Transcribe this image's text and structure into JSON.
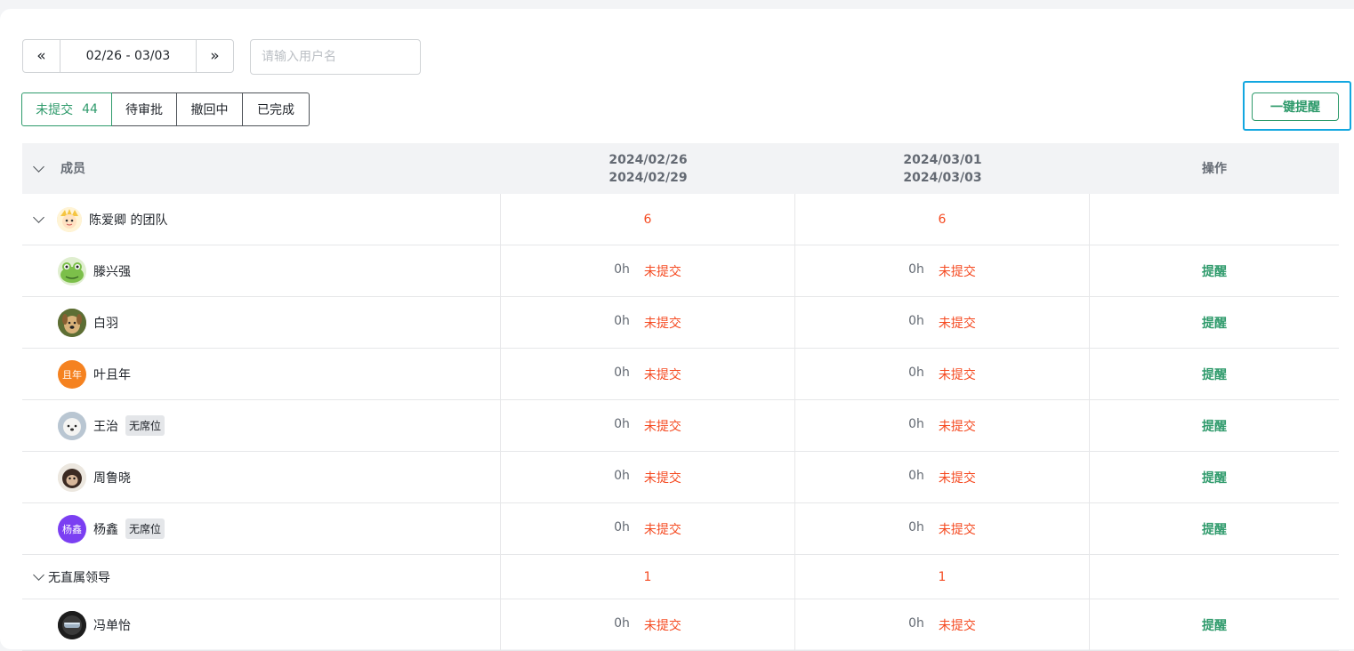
{
  "toolbar": {
    "date_range": "02/26 - 03/03",
    "prev_icon": "double-chevron-left-icon",
    "next_icon": "double-chevron-right-icon",
    "search_placeholder": "请输入用户名",
    "search_value": "",
    "remind_all_label": "一键提醒"
  },
  "status_tabs": [
    {
      "label": "未提交",
      "count": "44",
      "active": true
    },
    {
      "label": "待审批",
      "count": "",
      "active": false
    },
    {
      "label": "撤回中",
      "count": "",
      "active": false
    },
    {
      "label": "已完成",
      "count": "",
      "active": false
    }
  ],
  "table": {
    "headers": {
      "member": "成员",
      "week1_start": "2024/02/26",
      "week1_end": "2024/02/29",
      "week2_start": "2024/03/01",
      "week2_end": "2024/03/03",
      "operation": "操作"
    },
    "team1": {
      "name": "陈爱卿 的团队",
      "week1_count": "6",
      "week2_count": "6",
      "members": [
        {
          "name": "滕兴强",
          "avatar": "frog-avatar",
          "badge": "",
          "w1_hours": "0h",
          "w1_status": "未提交",
          "w2_hours": "0h",
          "w2_status": "未提交",
          "action": "提醒"
        },
        {
          "name": "白羽",
          "avatar": "dog-photo-avatar",
          "badge": "",
          "w1_hours": "0h",
          "w1_status": "未提交",
          "w2_hours": "0h",
          "w2_status": "未提交",
          "action": "提醒"
        },
        {
          "name": "叶且年",
          "avatar_text": "且年",
          "avatar_color": "#f58220",
          "badge": "",
          "w1_hours": "0h",
          "w1_status": "未提交",
          "w2_hours": "0h",
          "w2_status": "未提交",
          "action": "提醒"
        },
        {
          "name": "王治",
          "avatar": "white-dog-avatar",
          "badge": "无席位",
          "w1_hours": "0h",
          "w1_status": "未提交",
          "w2_hours": "0h",
          "w2_status": "未提交",
          "action": "提醒"
        },
        {
          "name": "周鲁晓",
          "avatar": "monkey-avatar",
          "badge": "",
          "w1_hours": "0h",
          "w1_status": "未提交",
          "w2_hours": "0h",
          "w2_status": "未提交",
          "action": "提醒"
        },
        {
          "name": "杨鑫",
          "avatar_text": "杨鑫",
          "avatar_color": "#7b3ff2",
          "badge": "无席位",
          "w1_hours": "0h",
          "w1_status": "未提交",
          "w2_hours": "0h",
          "w2_status": "未提交",
          "action": "提醒"
        }
      ]
    },
    "group2": {
      "name": "无直属领导",
      "week1_count": "1",
      "week2_count": "1",
      "members": [
        {
          "name": "冯单怡",
          "avatar": "helmet-avatar",
          "badge": "",
          "w1_hours": "0h",
          "w1_status": "未提交",
          "w2_hours": "0h",
          "w2_status": "未提交",
          "action": "提醒"
        }
      ]
    }
  },
  "colors": {
    "accent": "#2e9a6b",
    "warning": "#f54a21",
    "highlight": "#12a7e0"
  }
}
